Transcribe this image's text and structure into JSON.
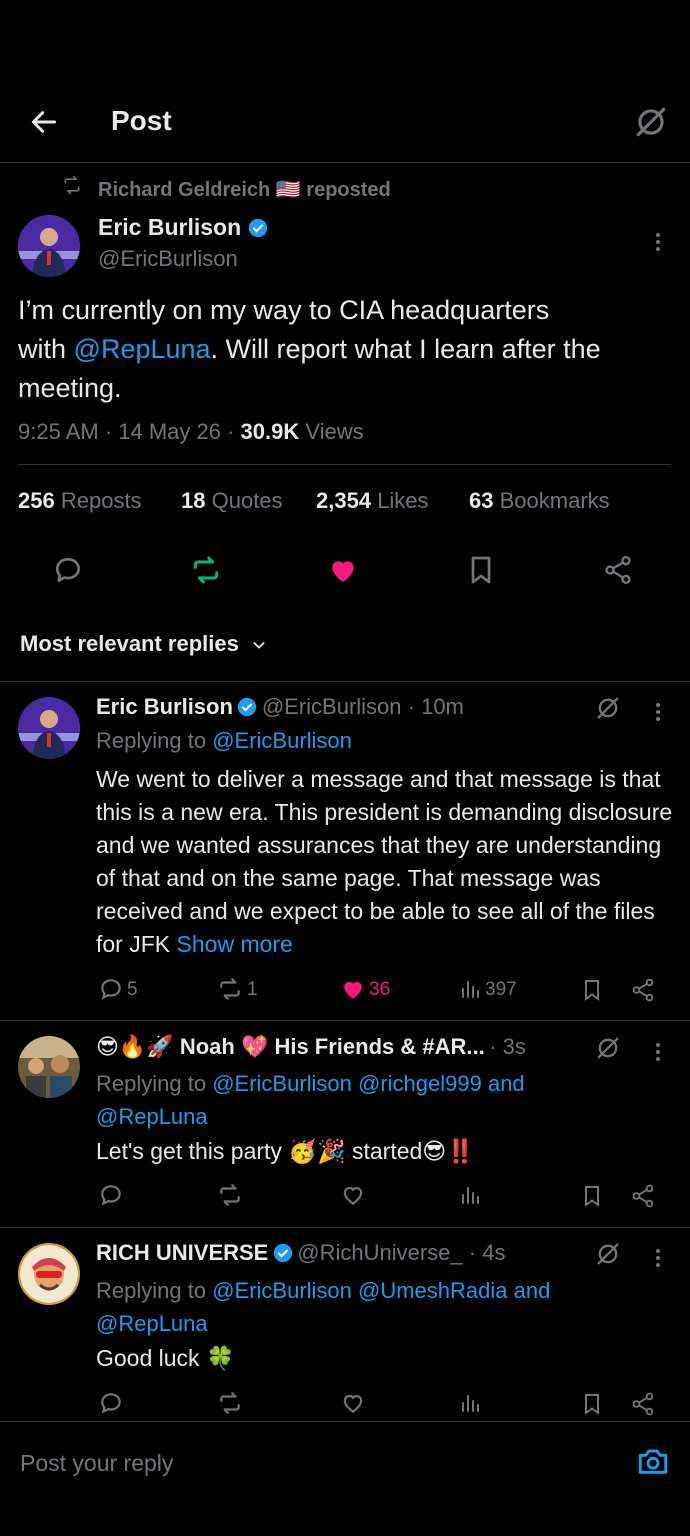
{
  "header": {
    "title": "Post"
  },
  "repost": {
    "text": "Richard Geldreich 🇺🇸 reposted"
  },
  "post": {
    "author_name": "Eric Burlison",
    "author_handle": "@EricBurlison",
    "text_line1": "I’m currently on my way to CIA headquarters",
    "text_with": "with ",
    "text_mention": "@RepLuna",
    "text_rest": ". Will report what I learn after the",
    "text_line3": "meeting.",
    "time": "9:25 AM · 14 May 26 · ",
    "views_count": "30.9K",
    "views_label": " Views"
  },
  "stats": {
    "reposts_count": "256",
    "reposts_label": "Reposts",
    "quotes_count": "18",
    "quotes_label": "Quotes",
    "likes_count": "2,354",
    "likes_label": "Likes",
    "bookmarks_count": "63",
    "bookmarks_label": "Bookmarks"
  },
  "sort": {
    "label": "Most relevant replies"
  },
  "replies": [
    {
      "name": "Eric Burlison",
      "meta": "@EricBurlison · 10m",
      "replying_prefix": "Replying to ",
      "replying_to": "@EricBurlison",
      "body": "We went to deliver a message and that message is that this is a new era. This president is demanding disclosure and we wanted assurances that they are understanding of that and on the same page. That message was received and we expect to be able to see all of the files for JFK ",
      "show_more": "Show more",
      "replies": "5",
      "reposts": "1",
      "likes": "36",
      "views": "397"
    },
    {
      "name": "😎🔥🚀 Noah 💖 His Friends & #AR...",
      "meta": "· 3s",
      "replying_prefix": "Replying to ",
      "replying_to": "@EricBurlison @richgel999 and",
      "replying_to2": "@RepLuna",
      "body": "Let's get this party 🥳🎉 started😎‼️"
    },
    {
      "name": "RICH UNIVERSE",
      "meta": "@RichUniverse_ · 4s",
      "replying_prefix": "Replying to ",
      "replying_to": "@EricBurlison @UmeshRadia and",
      "replying_to2": "@RepLuna",
      "body": "Good luck 🍀"
    }
  ],
  "composer": {
    "placeholder": "Post your reply"
  },
  "colors": {
    "accent": "#1d9bf0",
    "like": "#f91880",
    "repost": "#00ba7c",
    "divider": "#2f3336",
    "muted": "#71767b"
  }
}
